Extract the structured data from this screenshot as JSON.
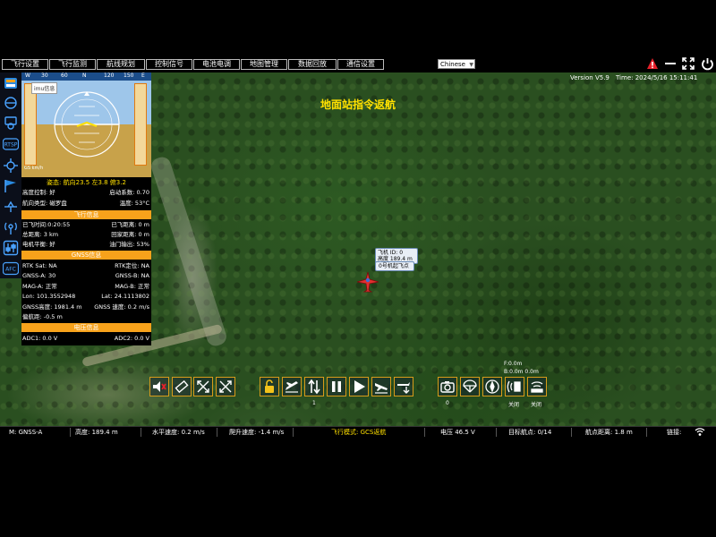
{
  "menu": [
    {
      "label": "飞行设置"
    },
    {
      "label": "飞行监测"
    },
    {
      "label": "航线规划"
    },
    {
      "label": "控制信号"
    },
    {
      "label": "电池电调"
    },
    {
      "label": "地图管理"
    },
    {
      "label": "数据回放"
    },
    {
      "label": "通信设置"
    }
  ],
  "language": "Chinese",
  "header": {
    "version": "Version V5.9",
    "time": "Time: 2024/5/16  15:11:41",
    "icons": [
      "alert-icon",
      "minimize-icon",
      "fullscreen-icon",
      "power-icon"
    ],
    "alert_color": "#e5202a"
  },
  "map": {
    "rth_message": "地面站指令返航",
    "aircraft_tag_line1": "飞机 ID: 0",
    "aircraft_tag_line2": "高度  189.4 m",
    "home_tag": "0号机起飞点",
    "aircraft_color": "#e03030"
  },
  "left_tools": [
    "battery-icon",
    "hud-icon",
    "gimbal-icon",
    "rtsp-icon",
    "crosshair-icon",
    "flag-icon",
    "drone-icon",
    "antenna-icon",
    "levels-icon",
    "afc-icon"
  ],
  "left_tools_text": {
    "rtsp": "RTSP",
    "afc": "AFC"
  },
  "attitude": {
    "imu_label": "imu信息",
    "compass": [
      "W",
      "30",
      "60",
      "N",
      "120",
      "150",
      "E"
    ],
    "speed_label": "GS  km/h",
    "summary": "姿态: 航向23.5  左3.8  俯3.2",
    "colors": {
      "sky": "#9ec6ea",
      "ground": "#c8a24a",
      "accent": "#f7a21b"
    }
  },
  "status_rows": [
    {
      "left": "高度控制: 好",
      "right": "启动系数: 0.70"
    },
    {
      "left": "航向类型: 磁罗盘",
      "right": "温度: 53°C"
    }
  ],
  "flight_info": {
    "title": "飞行信息",
    "rows": [
      {
        "left": "已飞时间:0:20:55",
        "right": "已飞距离: 0 m"
      },
      {
        "left": "总距离: 3 km",
        "right": "回家距离: 0 m"
      },
      {
        "left": "电机平衡: 好",
        "right": "油门输出: 53%"
      }
    ]
  },
  "gnss_info": {
    "title": "GNSS信息",
    "rows": [
      {
        "left": "RTK Sat: NA",
        "right": "RTK定位: NA"
      },
      {
        "left": "GNSS-A: 30",
        "right": "GNSS-B: NA"
      },
      {
        "left": "MAG-A: 正常",
        "right": "MAG-B: 正常"
      },
      {
        "left": "Lon: 101.3552948",
        "right": "Lat: 24.1113802"
      },
      {
        "left": "GNSS高度: 1981.4 m",
        "right": "GNSS 速度: 0.2 m/s"
      },
      {
        "left": "偏航距: -0.5 m",
        "right": ""
      }
    ]
  },
  "voltage_info": {
    "title": "电压信息",
    "rows": [
      {
        "left": "ADC1: 0.0 V",
        "right": "ADC2: 0.0 V"
      }
    ]
  },
  "actions": {
    "group1": [
      "mute-icon",
      "ruler-icon",
      "cross-arrows-icon",
      "cross-arrows-alt-icon"
    ],
    "group2": [
      "unlock-icon",
      "takeoff-icon",
      "swap-icon",
      "pause-icon",
      "play-icon",
      "land-icon",
      "descend-icon"
    ],
    "group3": [
      "camera-icon",
      "parachute-icon",
      "compass-icon",
      "radar-icon",
      "signal-icon"
    ],
    "group2_counter": "1",
    "group3_counter": "0",
    "radar_label": "关闭",
    "signal_label": "关闭",
    "f_distance": "F:0.0m",
    "b_distance": "B:0.0m    0.0m"
  },
  "statusbar": {
    "mode": "M: GNSS-A",
    "altitude": "高度: 189.4 m",
    "h_speed": "水平速度: 0.2 m/s",
    "climb": "爬升速度: -1.4 m/s",
    "flight_mode": "飞行模式:  GCS返航",
    "voltage": "电压  46.5 V",
    "waypoint": "目标航点: 0/14",
    "wp_distance": "航点距离: 1.8 m",
    "link": "链接:",
    "mode_color": "#ffe000"
  }
}
